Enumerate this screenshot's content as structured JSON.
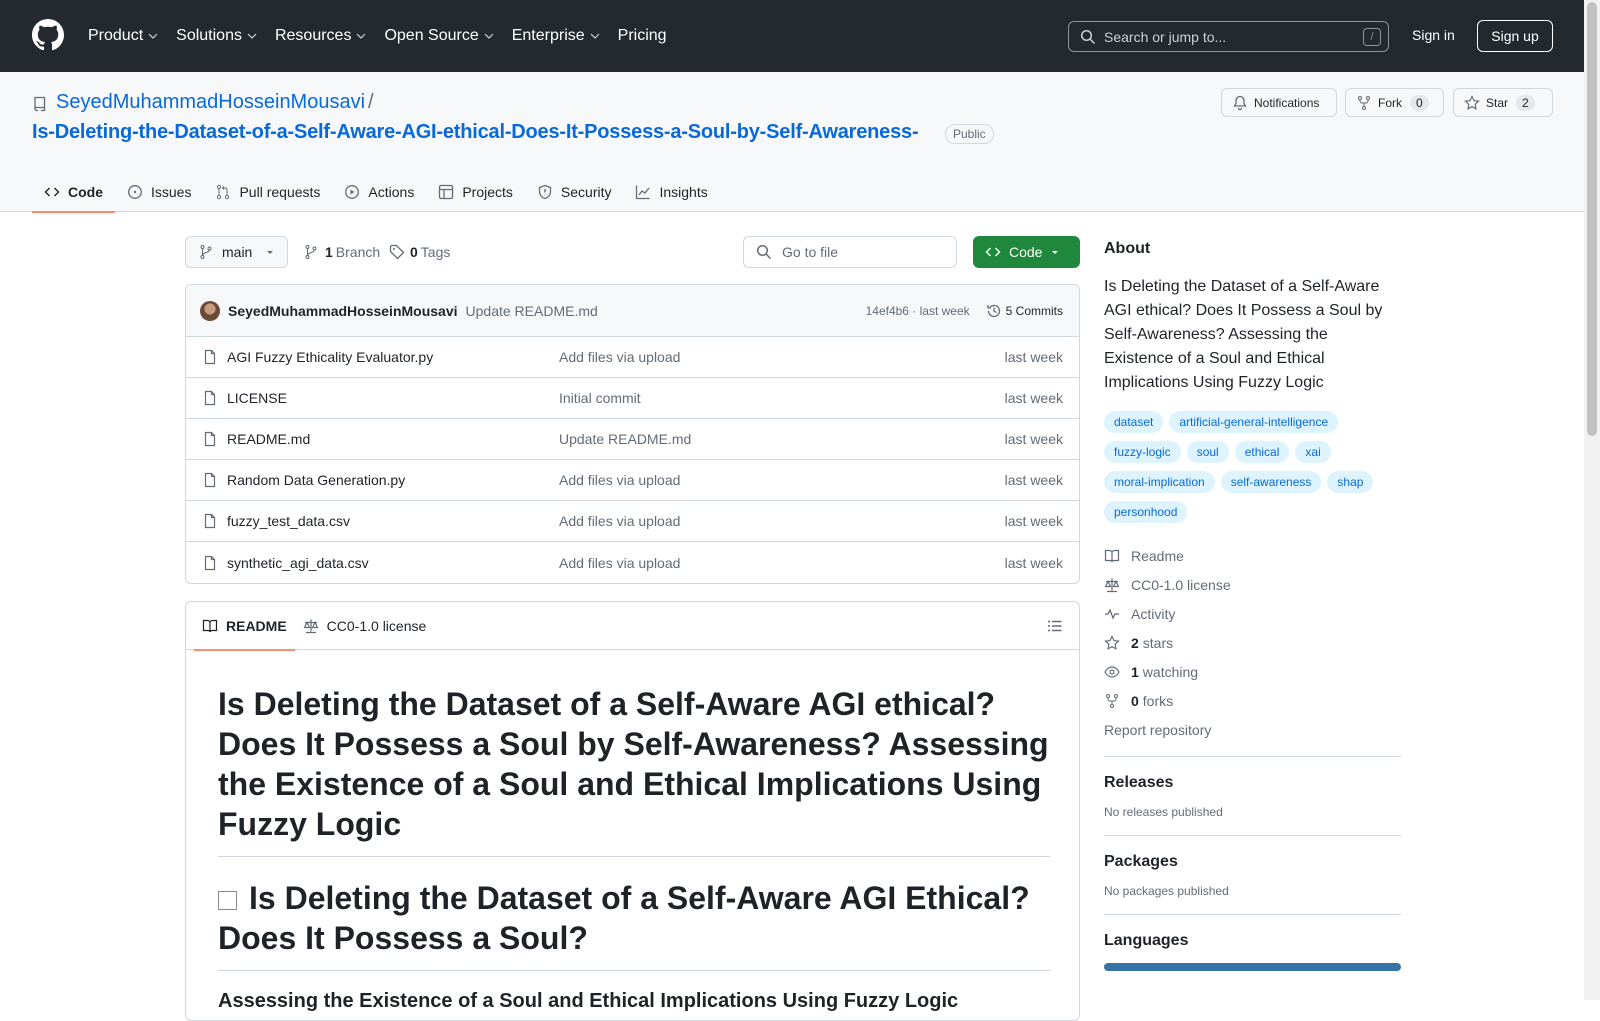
{
  "header": {
    "nav": [
      "Product",
      "Solutions",
      "Resources",
      "Open Source",
      "Enterprise",
      "Pricing"
    ],
    "search_placeholder": "Search or jump to...",
    "search_shortcut": "/",
    "signin": "Sign in",
    "signup": "Sign up"
  },
  "repo": {
    "owner": "SeyedMuhammadHosseinMousavi",
    "separator": "/",
    "name": "Is-Deleting-the-Dataset-of-a-Self-Aware-AGI-ethical-Does-It-Possess-a-Soul-by-Self-Awareness-",
    "visibility": "Public",
    "notifications": "Notifications",
    "fork_label": "Fork",
    "fork_count": "0",
    "star_label": "Star",
    "star_count": "2"
  },
  "tabs": [
    "Code",
    "Issues",
    "Pull requests",
    "Actions",
    "Projects",
    "Security",
    "Insights"
  ],
  "toolbar": {
    "branch": "main",
    "branch_count": "1",
    "branch_label": "Branch",
    "tag_count": "0",
    "tag_label": "Tags",
    "goto_placeholder": "Go to file",
    "code_button": "Code"
  },
  "commit": {
    "author": "SeyedMuhammadHosseinMousavi",
    "message": "Update README.md",
    "hash_time": "14ef4b6 · last week",
    "commits": "5 Commits"
  },
  "files": [
    {
      "name": "AGI Fuzzy Ethicality Evaluator.py",
      "message": "Add files via upload",
      "time": "last week"
    },
    {
      "name": "LICENSE",
      "message": "Initial commit",
      "time": "last week"
    },
    {
      "name": "README.md",
      "message": "Update README.md",
      "time": "last week"
    },
    {
      "name": "Random Data Generation.py",
      "message": "Add files via upload",
      "time": "last week"
    },
    {
      "name": "fuzzy_test_data.csv",
      "message": "Add files via upload",
      "time": "last week"
    },
    {
      "name": "synthetic_agi_data.csv",
      "message": "Add files via upload",
      "time": "last week"
    }
  ],
  "readme": {
    "tab_readme": "README",
    "tab_license": "CC0-1.0 license",
    "h1": "Is Deleting the Dataset of a Self-Aware AGI ethical? Does It Possess a Soul by Self-Awareness? Assessing the Existence of a Soul and Ethical Implications Using Fuzzy Logic",
    "h1b": "Is Deleting the Dataset of a Self-Aware AGI Ethical? Does It Possess a Soul?",
    "h3": "Assessing the Existence of a Soul and Ethical Implications Using Fuzzy Logic"
  },
  "about": {
    "title": "About",
    "description": "Is Deleting the Dataset of a Self-Aware AGI ethical? Does It Possess a Soul by Self-Awareness? Assessing the Existence of a Soul and Ethical Implications Using Fuzzy Logic",
    "topics": [
      "dataset",
      "artificial-general-intelligence",
      "fuzzy-logic",
      "soul",
      "ethical",
      "xai",
      "moral-implication",
      "self-awareness",
      "shap",
      "personhood"
    ],
    "readme": "Readme",
    "license": "CC0-1.0 license",
    "activity": "Activity",
    "stars_count": "2",
    "stars_label": "stars",
    "watching_count": "1",
    "watching_label": "watching",
    "forks_count": "0",
    "forks_label": "forks",
    "report": "Report repository"
  },
  "releases": {
    "title": "Releases",
    "text": "No releases published"
  },
  "packages": {
    "title": "Packages",
    "text": "No packages published"
  },
  "languages": {
    "title": "Languages",
    "bar_color": "#3572a5"
  },
  "colors": {
    "header_bg": "#24292f",
    "link": "#0969da",
    "code_button": "#1f883d",
    "tab_underline": "#fd8c73"
  }
}
